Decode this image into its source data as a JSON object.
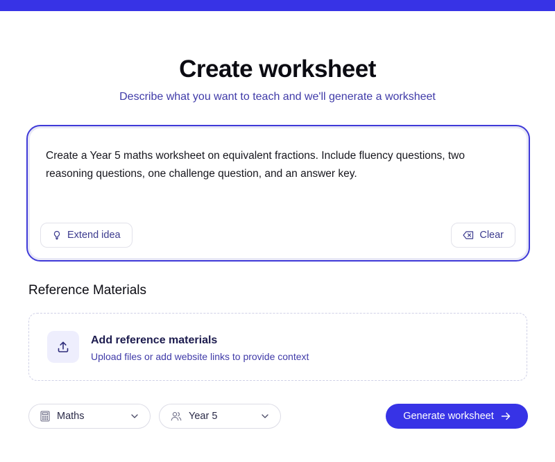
{
  "header": {
    "title": "Create worksheet",
    "subtitle": "Describe what you want to teach and we'll generate a worksheet"
  },
  "prompt": {
    "value": "Create a Year 5 maths worksheet on equivalent fractions. Include fluency questions, two reasoning questions, one challenge question, and an answer key.",
    "extend_label": "Extend idea",
    "clear_label": "Clear"
  },
  "reference": {
    "section_title": "Reference Materials",
    "add_title": "Add reference materials",
    "add_subtitle": "Upload files or add website links to provide context"
  },
  "controls": {
    "subject": {
      "selected": "Maths",
      "icon": "calculator-icon"
    },
    "year": {
      "selected": "Year 5",
      "icon": "users-icon"
    },
    "generate_label": "Generate worksheet"
  },
  "colors": {
    "accent": "#3733e6",
    "subtitle_text": "#3f3aa8",
    "upload_icon_bg": "#eeeefd"
  }
}
